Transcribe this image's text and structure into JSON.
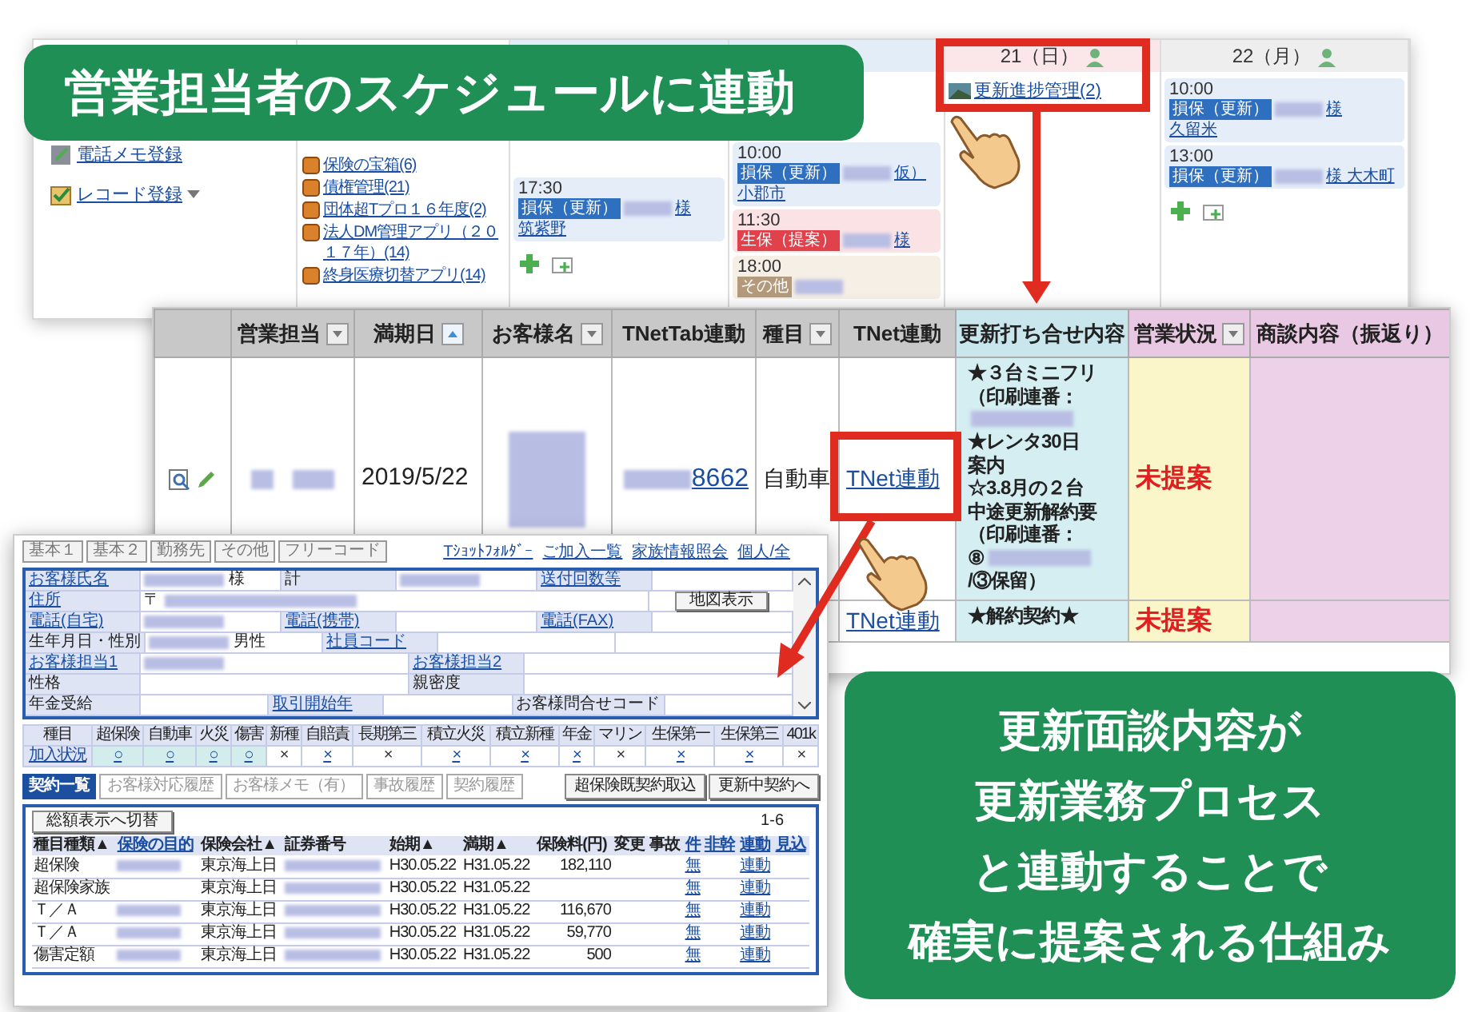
{
  "banner": "営業担当者のスケジュールに連動",
  "calendar": {
    "sidebar_links": [
      {
        "label": "電話メモ登録",
        "kind": "memo"
      },
      {
        "label": "レコード登録",
        "kind": "record"
      }
    ],
    "apps": [
      {
        "label": "保険の宝箱(6)"
      },
      {
        "label": "債権管理(21)"
      },
      {
        "label": "団体超Tプロ１６年度(2)"
      },
      {
        "label": "法人DM管理アプリ（２０１７年）(14)"
      },
      {
        "label": "終身医療切替アプリ(14)"
      }
    ],
    "days": [
      {
        "add_controls": true,
        "events": [
          {
            "time": "17:30",
            "kind": "renewal",
            "tag": "損保（更新）",
            "text": "様",
            "place": "筑紫野"
          }
        ]
      },
      {
        "add_controls": false,
        "events": [
          {
            "time": "10:00",
            "kind": "renewal",
            "tag": "損保（更新）",
            "text": "仮）",
            "place": "小郡市"
          },
          {
            "time": "11:30",
            "kind": "proposal",
            "tag": "生保（提案）",
            "text": "様"
          },
          {
            "time": "18:00",
            "kind": "other",
            "tag": "その他"
          }
        ]
      },
      {
        "header": "21（日）",
        "add_controls": false,
        "links": [
          "更新進捗管理(2)"
        ]
      },
      {
        "header": "22（月）",
        "add_controls": true,
        "events": [
          {
            "time": "10:00",
            "kind": "renewal",
            "tag": "損保（更新）",
            "text": "様",
            "place": "久留米"
          },
          {
            "time": "13:00",
            "kind": "renewal",
            "tag": "損保（更新）",
            "text": "様 大木町"
          }
        ]
      }
    ]
  },
  "table": {
    "columns": [
      {
        "label": "営業担当",
        "kind": "staff"
      },
      {
        "label": "満期日",
        "kind": "date"
      },
      {
        "label": "お客様名",
        "kind": "customer"
      },
      {
        "label": "TNetTab連動",
        "kind": "tablink"
      },
      {
        "label": "種目",
        "kind": "type"
      },
      {
        "label": "TNet連動",
        "kind": "link"
      },
      {
        "label": "更新打ち合せ内容",
        "kind": "memo"
      },
      {
        "label": "営業状況",
        "kind": "status"
      },
      {
        "label": "商談内容（振返り）",
        "kind": "notes"
      }
    ],
    "rows": [
      {
        "actions": true,
        "staff": true,
        "customer": true,
        "date": "2019/5/22",
        "tab_no": "8662",
        "type": "自動車",
        "link": "TNet連動",
        "memo": [
          {
            "text": "★３台ミニフリ",
            "blur": false
          },
          {
            "text": "（印刷連番：",
            "blur": true
          },
          {
            "text": "★レンタ30日",
            "blur": false
          },
          {
            "text": "案内",
            "blur": false
          },
          {
            "text": "☆3.8月の２台",
            "blur": false
          },
          {
            "text": "中途更新解約要",
            "blur": false
          },
          {
            "text": "（印刷連番：",
            "blur": false
          },
          {
            "text": "⑧",
            "blur": true
          },
          {
            "text": "/③保留）",
            "blur": false
          }
        ],
        "status": "未提案"
      },
      {
        "actions": false,
        "staff": false,
        "customer": false,
        "link": "TNet連動",
        "memo": [
          {
            "text": "★解約契約★",
            "blur": false
          }
        ],
        "status": "未提案"
      }
    ]
  },
  "detail": {
    "tabs": [
      "基本１",
      "基本２",
      "勤務先",
      "その他",
      "フリーコード"
    ],
    "links": [
      "Tｼｮｯﾄﾌｫﾙﾀﾞｰ",
      "ご加入一覧",
      "家族情報照会",
      "個人/全"
    ],
    "form": [
      [
        {
          "kind": "link",
          "text": "お客様氏名"
        },
        {
          "kind": "value",
          "text": "様",
          "blur_before": true
        },
        {
          "kind": "label",
          "text": "計"
        },
        {
          "kind": "value",
          "blur_before": true
        },
        {
          "kind": "link",
          "text": "送付回数等"
        },
        {
          "kind": "value"
        }
      ],
      [
        {
          "kind": "link",
          "text": "住所"
        },
        {
          "kind": "value",
          "text": "〒",
          "blur_after": true
        },
        {
          "kind": "button",
          "text": "地図表示"
        }
      ],
      [
        {
          "kind": "link",
          "text": "電話(自宅)"
        },
        {
          "kind": "value",
          "blur_before": true
        },
        {
          "kind": "link",
          "text": "電話(携帯)"
        },
        {
          "kind": "value"
        },
        {
          "kind": "link",
          "text": "電話(FAX)"
        },
        {
          "kind": "value"
        }
      ],
      [
        {
          "kind": "label",
          "text": "生年月日・性別"
        },
        {
          "kind": "value",
          "text": "男性",
          "blur_before": true
        },
        {
          "kind": "link",
          "text": "社員コード"
        },
        {
          "kind": "value"
        },
        {
          "kind": "value"
        }
      ],
      [
        {
          "kind": "link",
          "text": "お客様担当1"
        },
        {
          "kind": "value",
          "blur_before": true
        },
        {
          "kind": "link",
          "text": "お客様担当2"
        },
        {
          "kind": "value"
        }
      ],
      [
        {
          "kind": "label",
          "text": "性格"
        },
        {
          "kind": "value"
        },
        {
          "kind": "label",
          "text": "親密度"
        },
        {
          "kind": "value"
        }
      ],
      [
        {
          "kind": "label",
          "text": "年金受給"
        },
        {
          "kind": "value"
        },
        {
          "kind": "link",
          "text": "取引開始年"
        },
        {
          "kind": "value"
        },
        {
          "kind": "label",
          "text": "お客様問合せコード"
        },
        {
          "kind": "value"
        }
      ]
    ],
    "coverage": {
      "header": [
        "種目",
        "超保険",
        "自動車",
        "火災",
        "傷害",
        "新種",
        "自賠責",
        "長期第三",
        "積立火災",
        "積立新種",
        "年金",
        "マリン",
        "生保第一",
        "生保第三",
        "401k"
      ],
      "row_label": "加入状況",
      "cells": [
        {
          "mark": "○",
          "enrolled": true,
          "link": true
        },
        {
          "mark": "○",
          "enrolled": true,
          "link": true
        },
        {
          "mark": "○",
          "enrolled": true,
          "link": true
        },
        {
          "mark": "○",
          "enrolled": true,
          "link": true
        },
        {
          "mark": "×",
          "enrolled": false,
          "link": false
        },
        {
          "mark": "×",
          "enrolled": false,
          "link": true
        },
        {
          "mark": "×",
          "enrolled": false,
          "link": false
        },
        {
          "mark": "×",
          "enrolled": false,
          "link": true
        },
        {
          "mark": "×",
          "enrolled": false,
          "link": true
        },
        {
          "mark": "×",
          "enrolled": false,
          "link": true
        },
        {
          "mark": "×",
          "enrolled": false,
          "link": false
        },
        {
          "mark": "×",
          "enrolled": false,
          "link": true
        },
        {
          "mark": "×",
          "enrolled": false,
          "link": true
        },
        {
          "mark": "×",
          "enrolled": false,
          "link": false
        }
      ]
    },
    "list_tabs": [
      {
        "label": "契約一覧",
        "selected": true
      },
      {
        "label": "お客様対応履歴",
        "selected": false
      },
      {
        "label": "お客様メモ（有）",
        "selected": false
      },
      {
        "label": "事故履歴",
        "selected": false
      },
      {
        "label": "契約履歴",
        "selected": false
      }
    ],
    "buttons": [
      "超保険既契約取込",
      "更新中契約へ"
    ],
    "contracts": {
      "toggle": "総額表示へ切替",
      "count": "1-6",
      "columns": [
        {
          "label": "種目種類▲",
          "link": false
        },
        {
          "label": "保険の目的",
          "link": true
        },
        {
          "label": "保険会社▲",
          "link": false
        },
        {
          "label": "証券番号",
          "link": false
        },
        {
          "label": "始期▲",
          "link": false
        },
        {
          "label": "満期▲",
          "link": false
        },
        {
          "label": "保険料(円)",
          "link": false
        },
        {
          "label": "変更",
          "link": false
        },
        {
          "label": "事故",
          "link": false
        },
        {
          "label": "件",
          "link": true
        },
        {
          "label": "非幹",
          "link": true
        },
        {
          "label": "連動",
          "link": true
        },
        {
          "label": "見込",
          "link": true
        }
      ],
      "rows": [
        {
          "type": "超保険",
          "purpose_hidden": true,
          "company": "東京海上日",
          "start": "H30.05.22",
          "end": "H31.05.22",
          "premium": "182,110",
          "flag": "無",
          "link": "連動"
        },
        {
          "type": "超保険家族",
          "purpose_hidden": false,
          "company": "東京海上日",
          "start": "H30.05.22",
          "end": "H31.05.22",
          "flag": "無",
          "link": "連動"
        },
        {
          "type": "Ｔ／Ａ",
          "purpose_hidden": true,
          "company": "東京海上日",
          "start": "H30.05.22",
          "end": "H31.05.22",
          "premium": "116,670",
          "flag": "無",
          "link": "連動"
        },
        {
          "type": "Ｔ／Ａ",
          "purpose_hidden": true,
          "company": "東京海上日",
          "start": "H30.05.22",
          "end": "H31.05.22",
          "premium": "59,770",
          "flag": "無",
          "link": "連動"
        },
        {
          "type": "傷害定額",
          "purpose_hidden": true,
          "company": "東京海上日",
          "start": "H30.05.22",
          "end": "H31.05.22",
          "premium": "500",
          "flag": "無",
          "link": "連動"
        }
      ]
    }
  },
  "callout": [
    "更新面談内容が",
    "更新業務プロセス",
    "と連動することで",
    "確実に提案される仕組み"
  ]
}
